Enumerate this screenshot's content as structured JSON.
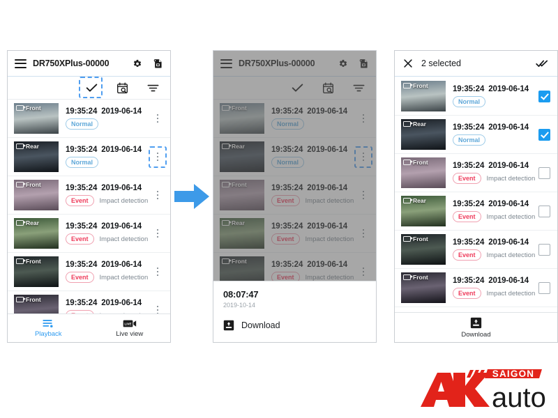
{
  "app": {
    "title": "DR750XPlus-00000",
    "menu_icon": "hamburger-icon",
    "settings_icon": "gear-icon",
    "firmware_icon": "device-file-icon"
  },
  "toolbar": {
    "select_icon": "check-icon",
    "calendar_icon": "calendar-search-icon",
    "filter_icon": "filter-icon"
  },
  "labels": {
    "normal": "Normal",
    "event": "Event",
    "impact": "Impact detection",
    "front": "Front",
    "rear": "Rear",
    "time": "19:35:24",
    "date": "2019-06-14"
  },
  "recordings": [
    {
      "camera": "Front",
      "time": "19:35:24",
      "date": "2019-06-14",
      "badge": "Normal",
      "badge_type": "normal",
      "note": "",
      "checked": true,
      "thumb": "road-dawn"
    },
    {
      "camera": "Rear",
      "time": "19:35:24",
      "date": "2019-06-14",
      "badge": "Normal",
      "badge_type": "normal",
      "note": "",
      "checked": true,
      "thumb": "night-traffic"
    },
    {
      "camera": "Front",
      "time": "19:35:24",
      "date": "2019-06-14",
      "badge": "Event",
      "badge_type": "event",
      "note": "Impact detection",
      "checked": false,
      "thumb": "city-road"
    },
    {
      "camera": "Rear",
      "time": "19:35:24",
      "date": "2019-06-14",
      "badge": "Event",
      "badge_type": "event",
      "note": "Impact detection",
      "checked": false,
      "thumb": "green-road"
    },
    {
      "camera": "Front",
      "time": "19:35:24",
      "date": "2019-06-14",
      "badge": "Event",
      "badge_type": "event",
      "note": "Impact detection",
      "checked": false,
      "thumb": "dark-road"
    },
    {
      "camera": "Front",
      "time": "19:35:24",
      "date": "2019-06-14",
      "badge": "Event",
      "badge_type": "event",
      "note": "Impact detection",
      "checked": false,
      "thumb": "night-city"
    }
  ],
  "bottom_nav": {
    "playback": {
      "label": "Playback",
      "icon": "playlist-icon",
      "active": true
    },
    "liveview": {
      "label": "Live view",
      "icon": "live-camera-icon",
      "active": false
    }
  },
  "sheet": {
    "time": "08:07:47",
    "date": "2019-10-14",
    "download_label": "Download",
    "download_icon": "download-icon"
  },
  "selection": {
    "close_icon": "close-icon",
    "title": "2 selected",
    "select_all_icon": "double-check-icon",
    "download_label": "Download",
    "download_icon": "download-icon"
  },
  "arrow": {
    "name": "flow-arrow-right",
    "color": "#3d9ae8"
  },
  "logo": {
    "primary": "AK",
    "secondary": "auto",
    "banner": "SAIGON",
    "red": "#e2231a",
    "black": "#1a1a1a"
  },
  "colors": {
    "accent": "#2e9bf0",
    "normal_badge": "#5fa8d9",
    "event_badge": "#ef3b5b",
    "dashed_highlight": "#4f9ef0"
  }
}
